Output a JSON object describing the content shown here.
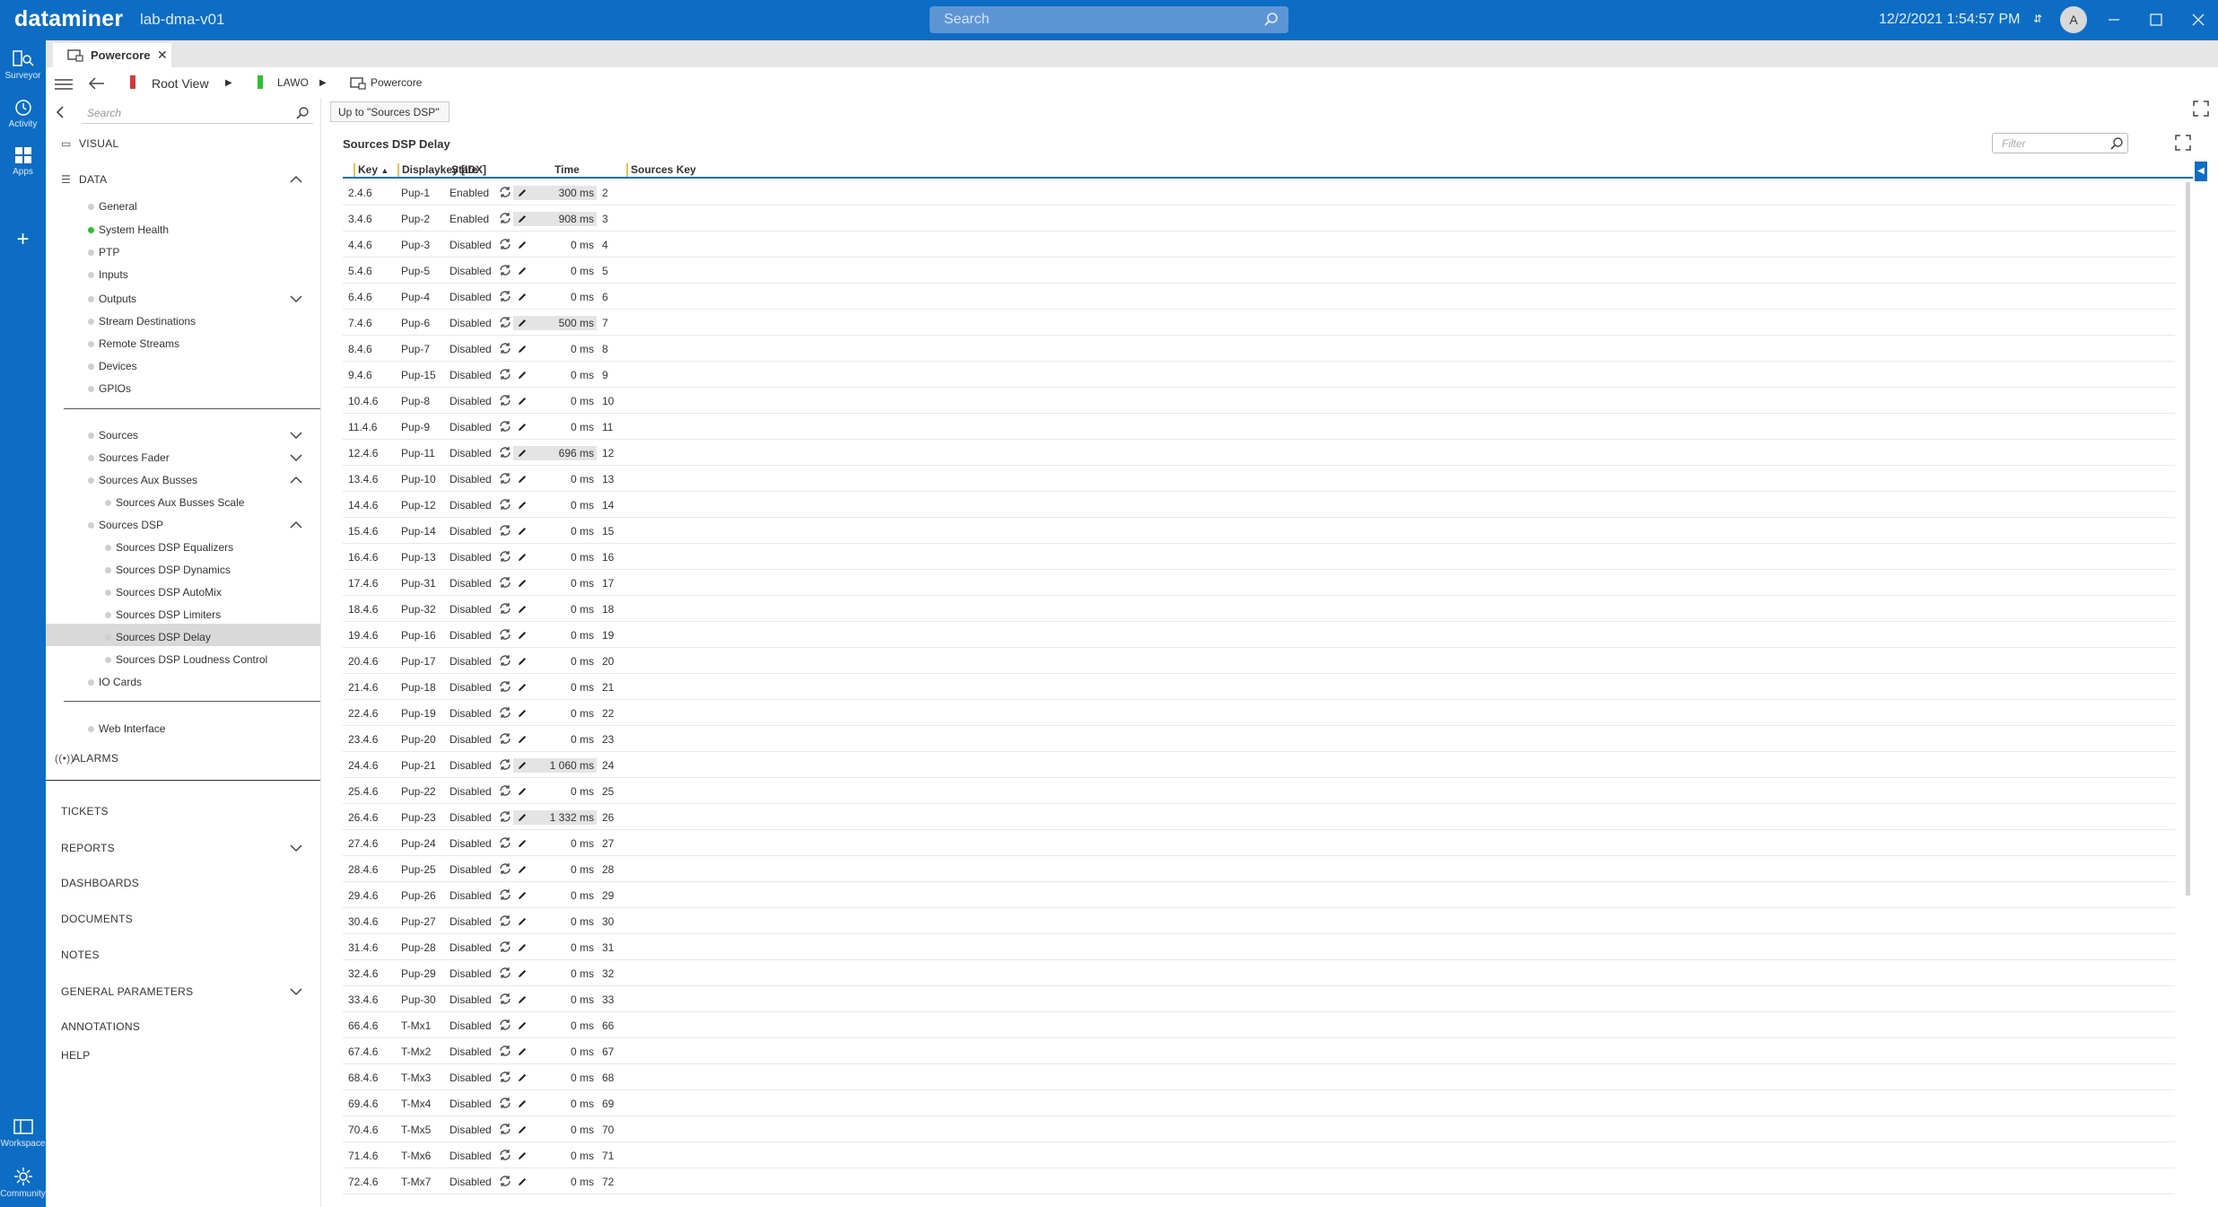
{
  "app": {
    "brand": "dataminer",
    "environment": "lab-dma-v01",
    "search_placeholder": "Search",
    "datetime": "12/2/2021 1:54:57 PM",
    "avatar_initial": "A",
    "accent_color": "#0d6dc4"
  },
  "rail": {
    "surveyor": "Surveyor",
    "activity": "Activity",
    "apps": "Apps",
    "workspace": "Workspace",
    "community": "Community"
  },
  "tab": {
    "label": "Powercore"
  },
  "breadcrumb": {
    "root": "Root View",
    "lawo": "LAWO",
    "element": "Powercore"
  },
  "sidebar": {
    "search_placeholder": "Search",
    "visual": "VISUAL",
    "data": "DATA",
    "items": {
      "general": "General",
      "system_health": "System Health",
      "ptp": "PTP",
      "inputs": "Inputs",
      "outputs": "Outputs",
      "stream_destinations": "Stream Destinations",
      "remote_streams": "Remote Streams",
      "devices": "Devices",
      "gpios": "GPIOs",
      "sources": "Sources",
      "sources_fader": "Sources Fader",
      "sources_aux_busses": "Sources Aux Busses",
      "sources_aux_busses_scale": "Sources Aux Busses Scale",
      "sources_dsp": "Sources DSP",
      "sources_dsp_equalizers": "Sources DSP Equalizers",
      "sources_dsp_dynamics": "Sources DSP Dynamics",
      "sources_dsp_automix": "Sources DSP AutoMix",
      "sources_dsp_limiters": "Sources DSP Limiters",
      "sources_dsp_delay": "Sources DSP Delay",
      "sources_dsp_loudness_control": "Sources DSP Loudness Control",
      "io_cards": "IO Cards",
      "web_interface": "Web Interface"
    },
    "alarms": "ALARMS",
    "tickets": "TICKETS",
    "reports": "REPORTS",
    "dashboards": "DASHBOARDS",
    "documents": "DOCUMENTS",
    "notes": "NOTES",
    "general_parameters": "GENERAL PARAMETERS",
    "annotations": "ANNOTATIONS",
    "help": "HELP"
  },
  "main": {
    "up_button": "Up to \"Sources DSP\"",
    "table_title": "Sources DSP Delay",
    "filter_placeholder": "Filter",
    "columns": {
      "key": "Key",
      "displaykey": "Displaykey [IDX]",
      "state": "State",
      "time": "Time",
      "sources_key": "Sources Key"
    },
    "rows": [
      {
        "key": "2.4.6",
        "displaykey": "Pup-1",
        "state": "Enabled",
        "time": "300 ms",
        "sources_key": "2",
        "highlight": true
      },
      {
        "key": "3.4.6",
        "displaykey": "Pup-2",
        "state": "Enabled",
        "time": "908 ms",
        "sources_key": "3",
        "highlight": true
      },
      {
        "key": "4.4.6",
        "displaykey": "Pup-3",
        "state": "Disabled",
        "time": "0 ms",
        "sources_key": "4",
        "highlight": false
      },
      {
        "key": "5.4.6",
        "displaykey": "Pup-5",
        "state": "Disabled",
        "time": "0 ms",
        "sources_key": "5",
        "highlight": false
      },
      {
        "key": "6.4.6",
        "displaykey": "Pup-4",
        "state": "Disabled",
        "time": "0 ms",
        "sources_key": "6",
        "highlight": false
      },
      {
        "key": "7.4.6",
        "displaykey": "Pup-6",
        "state": "Disabled",
        "time": "500 ms",
        "sources_key": "7",
        "highlight": true
      },
      {
        "key": "8.4.6",
        "displaykey": "Pup-7",
        "state": "Disabled",
        "time": "0 ms",
        "sources_key": "8",
        "highlight": false
      },
      {
        "key": "9.4.6",
        "displaykey": "Pup-15",
        "state": "Disabled",
        "time": "0 ms",
        "sources_key": "9",
        "highlight": false
      },
      {
        "key": "10.4.6",
        "displaykey": "Pup-8",
        "state": "Disabled",
        "time": "0 ms",
        "sources_key": "10",
        "highlight": false
      },
      {
        "key": "11.4.6",
        "displaykey": "Pup-9",
        "state": "Disabled",
        "time": "0 ms",
        "sources_key": "11",
        "highlight": false
      },
      {
        "key": "12.4.6",
        "displaykey": "Pup-11",
        "state": "Disabled",
        "time": "696 ms",
        "sources_key": "12",
        "highlight": true
      },
      {
        "key": "13.4.6",
        "displaykey": "Pup-10",
        "state": "Disabled",
        "time": "0 ms",
        "sources_key": "13",
        "highlight": false
      },
      {
        "key": "14.4.6",
        "displaykey": "Pup-12",
        "state": "Disabled",
        "time": "0 ms",
        "sources_key": "14",
        "highlight": false
      },
      {
        "key": "15.4.6",
        "displaykey": "Pup-14",
        "state": "Disabled",
        "time": "0 ms",
        "sources_key": "15",
        "highlight": false
      },
      {
        "key": "16.4.6",
        "displaykey": "Pup-13",
        "state": "Disabled",
        "time": "0 ms",
        "sources_key": "16",
        "highlight": false
      },
      {
        "key": "17.4.6",
        "displaykey": "Pup-31",
        "state": "Disabled",
        "time": "0 ms",
        "sources_key": "17",
        "highlight": false
      },
      {
        "key": "18.4.6",
        "displaykey": "Pup-32",
        "state": "Disabled",
        "time": "0 ms",
        "sources_key": "18",
        "highlight": false
      },
      {
        "key": "19.4.6",
        "displaykey": "Pup-16",
        "state": "Disabled",
        "time": "0 ms",
        "sources_key": "19",
        "highlight": false
      },
      {
        "key": "20.4.6",
        "displaykey": "Pup-17",
        "state": "Disabled",
        "time": "0 ms",
        "sources_key": "20",
        "highlight": false
      },
      {
        "key": "21.4.6",
        "displaykey": "Pup-18",
        "state": "Disabled",
        "time": "0 ms",
        "sources_key": "21",
        "highlight": false
      },
      {
        "key": "22.4.6",
        "displaykey": "Pup-19",
        "state": "Disabled",
        "time": "0 ms",
        "sources_key": "22",
        "highlight": false
      },
      {
        "key": "23.4.6",
        "displaykey": "Pup-20",
        "state": "Disabled",
        "time": "0 ms",
        "sources_key": "23",
        "highlight": false
      },
      {
        "key": "24.4.6",
        "displaykey": "Pup-21",
        "state": "Disabled",
        "time": "1 060 ms",
        "sources_key": "24",
        "highlight": true
      },
      {
        "key": "25.4.6",
        "displaykey": "Pup-22",
        "state": "Disabled",
        "time": "0 ms",
        "sources_key": "25",
        "highlight": false
      },
      {
        "key": "26.4.6",
        "displaykey": "Pup-23",
        "state": "Disabled",
        "time": "1 332 ms",
        "sources_key": "26",
        "highlight": true
      },
      {
        "key": "27.4.6",
        "displaykey": "Pup-24",
        "state": "Disabled",
        "time": "0 ms",
        "sources_key": "27",
        "highlight": false
      },
      {
        "key": "28.4.6",
        "displaykey": "Pup-25",
        "state": "Disabled",
        "time": "0 ms",
        "sources_key": "28",
        "highlight": false
      },
      {
        "key": "29.4.6",
        "displaykey": "Pup-26",
        "state": "Disabled",
        "time": "0 ms",
        "sources_key": "29",
        "highlight": false
      },
      {
        "key": "30.4.6",
        "displaykey": "Pup-27",
        "state": "Disabled",
        "time": "0 ms",
        "sources_key": "30",
        "highlight": false
      },
      {
        "key": "31.4.6",
        "displaykey": "Pup-28",
        "state": "Disabled",
        "time": "0 ms",
        "sources_key": "31",
        "highlight": false
      },
      {
        "key": "32.4.6",
        "displaykey": "Pup-29",
        "state": "Disabled",
        "time": "0 ms",
        "sources_key": "32",
        "highlight": false
      },
      {
        "key": "33.4.6",
        "displaykey": "Pup-30",
        "state": "Disabled",
        "time": "0 ms",
        "sources_key": "33",
        "highlight": false
      },
      {
        "key": "66.4.6",
        "displaykey": "T-Mx1",
        "state": "Disabled",
        "time": "0 ms",
        "sources_key": "66",
        "highlight": false
      },
      {
        "key": "67.4.6",
        "displaykey": "T-Mx2",
        "state": "Disabled",
        "time": "0 ms",
        "sources_key": "67",
        "highlight": false
      },
      {
        "key": "68.4.6",
        "displaykey": "T-Mx3",
        "state": "Disabled",
        "time": "0 ms",
        "sources_key": "68",
        "highlight": false
      },
      {
        "key": "69.4.6",
        "displaykey": "T-Mx4",
        "state": "Disabled",
        "time": "0 ms",
        "sources_key": "69",
        "highlight": false
      },
      {
        "key": "70.4.6",
        "displaykey": "T-Mx5",
        "state": "Disabled",
        "time": "0 ms",
        "sources_key": "70",
        "highlight": false
      },
      {
        "key": "71.4.6",
        "displaykey": "T-Mx6",
        "state": "Disabled",
        "time": "0 ms",
        "sources_key": "71",
        "highlight": false
      },
      {
        "key": "72.4.6",
        "displaykey": "T-Mx7",
        "state": "Disabled",
        "time": "0 ms",
        "sources_key": "72",
        "highlight": false
      }
    ]
  }
}
